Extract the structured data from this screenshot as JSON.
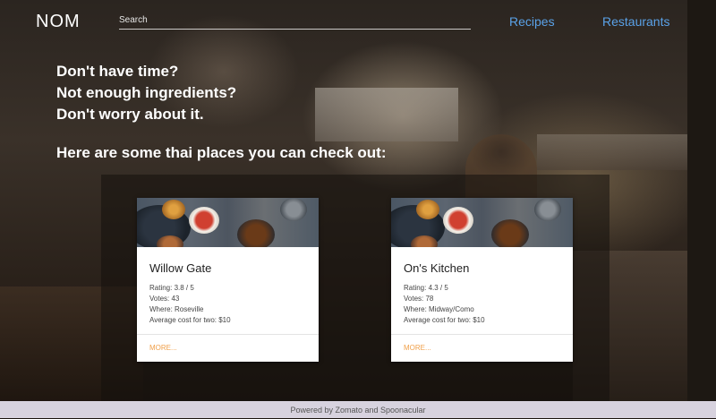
{
  "app": {
    "logo": "NOM"
  },
  "search": {
    "placeholder": "Search",
    "value": ""
  },
  "nav": {
    "recipes": "Recipes",
    "restaurants": "Restaurants"
  },
  "hero": {
    "lines": [
      "Don't have time?",
      "Not enough ingredients?",
      "Don't worry about it."
    ],
    "subheading": "Here are some thai places you can check out:"
  },
  "restaurants": [
    {
      "name": "Willow Gate",
      "rating": "Rating: 3.8 / 5",
      "votes": "Votes: 43",
      "where": "Where: Roseville",
      "cost": "Average cost for two: $10",
      "more": "MORE..."
    },
    {
      "name": "On's Kitchen",
      "rating": "Rating: 4.3 / 5",
      "votes": "Votes: 78",
      "where": "Where: Midway/Como",
      "cost": "Average cost for two: $10",
      "more": "MORE..."
    }
  ],
  "footer": {
    "text": "Powered by Zomato and Spoonacular"
  },
  "colors": {
    "nav_link": "#5aa2e8",
    "more_link": "#f0a04a",
    "footer_bg": "#d7d2de"
  }
}
